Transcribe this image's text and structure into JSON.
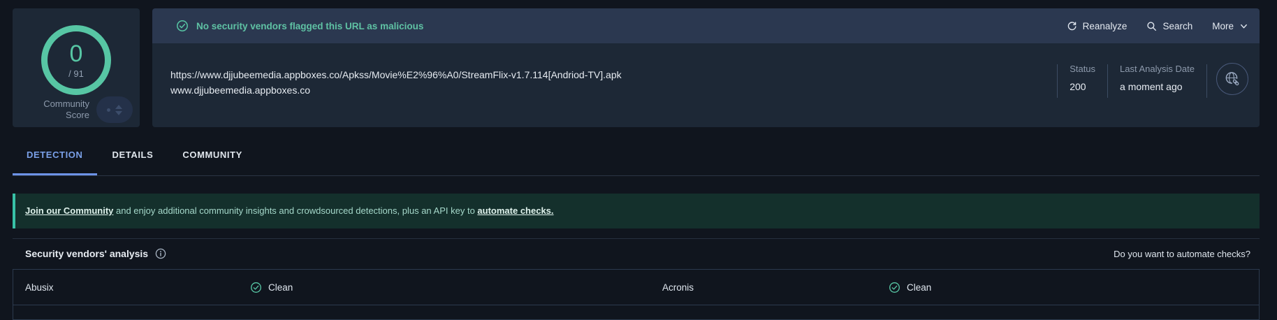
{
  "score_card": {
    "score": "0",
    "denominator": "/ 91",
    "label": "Community\nScore"
  },
  "header": {
    "verdict": "No security vendors flagged this URL as malicious",
    "actions": [
      {
        "label": "Reanalyze",
        "icon": "reanalyze-icon"
      },
      {
        "label": "Search",
        "icon": "search-icon"
      },
      {
        "label": "More",
        "icon": "chevron-down-icon"
      }
    ],
    "url": "https://www.djjubeemedia.appboxes.co/Apkss/Movie%E2%96%A0/StreamFlix-v1.7.114[Andriod-TV].apk",
    "domain": "www.djjubeemedia.appboxes.co",
    "status_label": "Status",
    "status_value": "200",
    "last_analysis_label": "Last Analysis Date",
    "last_analysis_value": "a moment ago"
  },
  "tabs": [
    {
      "label": "DETECTION",
      "active": true
    },
    {
      "label": "DETAILS",
      "active": false
    },
    {
      "label": "COMMUNITY",
      "active": false
    }
  ],
  "community_banner": {
    "link_community": "Join our Community",
    "text_middle": " and enjoy additional community insights and crowdsourced detections, plus an API key to ",
    "link_automate": "automate checks."
  },
  "analysis": {
    "title": "Security vendors' analysis",
    "automate_prompt": "Do you want to automate checks?"
  },
  "vendors": [
    {
      "name": "Abusix",
      "result": "Clean"
    },
    {
      "name": "Acronis",
      "result": "Clean"
    }
  ],
  "colors": {
    "page_bg": "#10151e",
    "panel_bg": "#1d2836",
    "strip_bg": "#2b3850",
    "accent_teal": "#57c6a4",
    "active_tab_blue": "#7aa0e8",
    "community_banner_bg": "#14302c",
    "community_banner_accent": "#38c2a7"
  }
}
